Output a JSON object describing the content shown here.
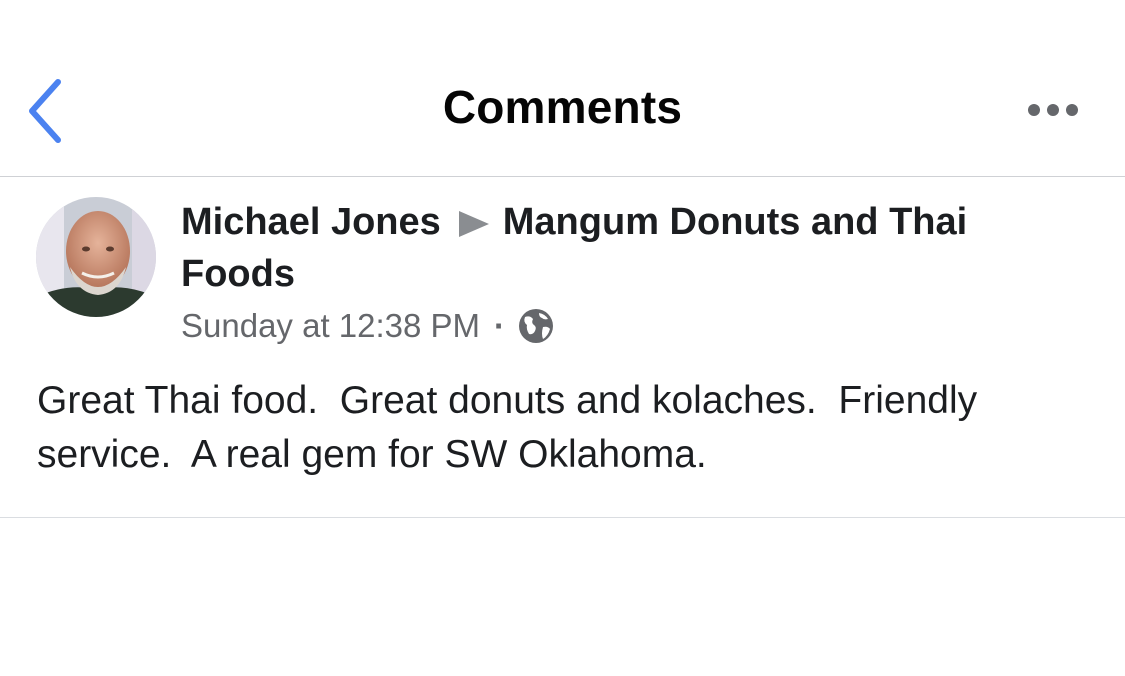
{
  "nav": {
    "title": "Comments",
    "back_icon": "chevron-left-icon",
    "more_icon": "more-horizontal-icon",
    "accent_color": "#4b82f0"
  },
  "post": {
    "author": "Michael Jones",
    "separator_icon": "triangle-right-icon",
    "target": "Mangum Donuts and Thai Foods",
    "timestamp": "Sunday at 12:38 PM",
    "meta_separator": "·",
    "privacy_icon": "globe-icon",
    "text": "Great Thai food.  Great donuts and kolaches.  Friendly service.  A real gem for SW Oklahoma."
  }
}
